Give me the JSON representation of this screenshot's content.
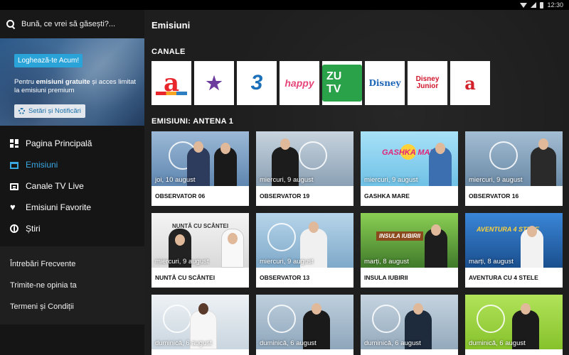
{
  "status_bar": {
    "time": "12:30"
  },
  "search": {
    "placeholder": "Bună, ce vrei să găsești?..."
  },
  "promo": {
    "login_label": "Loghează-te Acum!",
    "text_before": "Pentru ",
    "text_bold": "emisiuni gratuite",
    "text_after": " și acces limitat la emisiuni premium",
    "settings_label": "Setări și Notificări"
  },
  "nav": [
    {
      "label": "Pagina Principală",
      "icon": "dashboard-icon",
      "active": false
    },
    {
      "label": "Emisiuni",
      "icon": "tv-icon",
      "active": true
    },
    {
      "label": "Canale TV Live",
      "icon": "live-tv-icon",
      "active": false
    },
    {
      "label": "Emisiuni Favorite",
      "icon": "heart-icon",
      "active": false
    },
    {
      "label": "Știri",
      "icon": "globe-icon",
      "active": false
    }
  ],
  "secondary_nav": [
    "Întrebări Frecvente",
    "Trimite-ne opinia ta",
    "Termeni și Condiții"
  ],
  "main": {
    "title": "Emisiuni",
    "channels_heading": "CANALE",
    "shows_heading": "EMISIUNI: ANTENA 1"
  },
  "channels": [
    {
      "name": "Antena 1",
      "logo": "a"
    },
    {
      "name": "Antena Stars",
      "logo": "★"
    },
    {
      "name": "Antena 3",
      "logo": "3"
    },
    {
      "name": "Happy Channel",
      "logo": "happy"
    },
    {
      "name": "ZU TV",
      "logo": "ZU TV"
    },
    {
      "name": "Disney Channel",
      "logo": "Disney"
    },
    {
      "name": "Disney Junior",
      "logo": "Disney Junior"
    },
    {
      "name": "Antena 3 CNN",
      "logo": "a"
    }
  ],
  "shows": [
    {
      "date": "joi, 10 august",
      "title": "OBSERVATOR 06",
      "bg": "#7d9fc4"
    },
    {
      "date": "miercuri, 9 august",
      "title": "OBSERVATOR 19",
      "bg": "#b9c8d6"
    },
    {
      "date": "miercuri, 9 august",
      "title": "GASHKA MARE",
      "bg": "#8fd3f0",
      "logo": "GASHKA MARE"
    },
    {
      "date": "miercuri, 9 august",
      "title": "OBSERVATOR 16",
      "bg": "#7fa1bd"
    },
    {
      "date": "miercuri, 9 august",
      "title": "NUNTĂ CU SCÂNTEI",
      "bg": "#eeeeee",
      "overlay": "NUNTĂ CU SCÂNTEI"
    },
    {
      "date": "miercuri, 9 august",
      "title": "OBSERVATOR 13",
      "bg": "#9fc6e0"
    },
    {
      "date": "marți, 8 august",
      "title": "INSULA IUBIRII",
      "bg": "#6aa03a"
    },
    {
      "date": "marți, 8 august",
      "title": "AVENTURA CU 4 STELE",
      "bg": "#2a6fc0"
    },
    {
      "date": "duminică, 6 august",
      "title": "",
      "bg": "#dfe7ee"
    },
    {
      "date": "duminică, 6 august",
      "title": "",
      "bg": "#a9bfd1"
    },
    {
      "date": "duminică, 6 august",
      "title": "",
      "bg": "#b4c6d4"
    },
    {
      "date": "duminică, 6 august",
      "title": "",
      "bg": "#9ad43a"
    }
  ]
}
